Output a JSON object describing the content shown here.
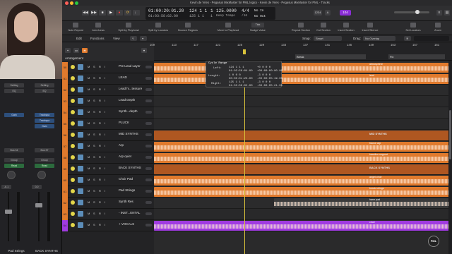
{
  "window": {
    "title": "Kevin de Vries - Pegasus MixMaster for PML.logicx - Kevin de Vries - Pegasus MixMaster for PML - Tracks"
  },
  "lcd": {
    "time_top": "01:00:20:01.20",
    "time_bottom": "01:03:58:02.00",
    "bars_top": "124 1 1",
    "bars_top_sub": "1",
    "bars_bottom": "125 1 1",
    "bars_bottom_sub": "1",
    "tempo": "125.0000",
    "tempo_label": "Keep Tempo",
    "sig": "4/4",
    "sig_bottom": "/16",
    "in_label": "No In",
    "out_label": "No Out"
  },
  "control": {
    "cpu_badge": "104",
    "btn_1234": "1234",
    "btn_a": "A"
  },
  "toolbar": {
    "items": [
      "Note Repeat",
      "Join Areas",
      "Split by Playhead",
      "Split by Locators",
      "Bounce Regions",
      "Move to Playhead",
      "Nudge Value",
      "Repeat Section",
      "Cut Section",
      "Insert Section",
      "Insert Silence",
      "Set Locators",
      "Zoom"
    ],
    "nudge_value": "Tick"
  },
  "trackbar": {
    "edit": "Edit",
    "functions": "Functions",
    "view": "View",
    "snap_label": "Snap:",
    "snap_value": "Smart",
    "drag_label": "Drag:",
    "drag_value": "No Overlap"
  },
  "ruler": {
    "bars": [
      "109",
      "113",
      "117",
      "121",
      "125",
      "129",
      "133",
      "137",
      "141",
      "145",
      "149",
      "153",
      "157",
      "161",
      "165"
    ],
    "markers": {
      "break": "Break",
      "fix": "Fix"
    },
    "arrangement": "Arrangement"
  },
  "tracks": [
    {
      "num": "50",
      "name": "Pre Lead Layer",
      "color": "#e07a2d"
    },
    {
      "num": "51",
      "name": "LEAD",
      "color": "#e07a2d"
    },
    {
      "num": "52",
      "name": "Lead hi...tessure",
      "color": "#e07a2d"
    },
    {
      "num": "53",
      "name": "Lead Depth",
      "color": "#e07a2d"
    },
    {
      "num": "54",
      "name": "Synth...depth",
      "color": "#e07a2d"
    },
    {
      "num": "55",
      "name": "PLUCK",
      "color": "#e07a2d"
    },
    {
      "num": "56",
      "name": "MID SYNTHS",
      "color": "#e07a2d"
    },
    {
      "num": "57",
      "name": "Arp",
      "color": "#e07a2d"
    },
    {
      "num": "58",
      "name": "Arp quiet",
      "color": "#e07a2d"
    },
    {
      "num": "59",
      "name": "BACK SYNTHS",
      "color": "#e07a2d"
    },
    {
      "num": "60",
      "name": "Choir Pad",
      "color": "#e07a2d"
    },
    {
      "num": "61",
      "name": "Pad Strings",
      "color": "#e07a2d"
    },
    {
      "num": "62",
      "name": "Synth Res",
      "color": "#e07a2d"
    },
    {
      "num": "63",
      "name": "- INST...ENTAL",
      "color": "#e07a2d"
    },
    {
      "num": "64",
      "name": "+ VOCALS",
      "color": "#a03be0"
    }
  ],
  "track_buttons": {
    "m": "M",
    "s": "S",
    "r": "R",
    "i": "I"
  },
  "regions": {
    "atmosphere": "atmosphere",
    "lead": "lead",
    "mid_synths": "MID SYNTHS",
    "trance_arp": "trance arp",
    "bassline_support": "bassline support",
    "back_synths": "BACK SYNTHS",
    "angel_choir": "angel choir",
    "break_strings": "break strings",
    "synth_res": "harm pad",
    "vocals": "choir"
  },
  "cycle_popup": {
    "title": "Cycle Range",
    "left_label": "Left:",
    "left_bars": "124 1 1 1",
    "left_time": "01:03:56:04.00",
    "left_delta": "+0 0 0 0",
    "left_delta_time": "+00:00:00:00.00",
    "length_label": "Length:",
    "length_bars": "1 0 0 0",
    "length_time": "00:00:01:23.00",
    "length_delta": "-3 0 0 0",
    "length_delta_time": "-00:00:05:19.00",
    "right_label": "Right:",
    "right_bars": "125 1 1 1",
    "right_time": "01:03:58:02.00",
    "right_delta": "-3 0 0 0",
    "right_delta_time": "-00:00:05:21.00"
  },
  "mixer": {
    "left_strip": {
      "name": "Pad Strings",
      "setting": "Setting",
      "eq": "EQ",
      "output": "Bus 34",
      "group": "Group",
      "auto": "Read",
      "vol": "-6.1",
      "pan": "0"
    },
    "right_strip": {
      "name": "BACK SYNTHS",
      "setting": "Setting",
      "eq": "EQ",
      "output": "Bus 37",
      "group": "Group",
      "auto": "Read",
      "vol": "0.0",
      "pan": "0"
    },
    "left_slots": [
      "Gain",
      "",
      "",
      ""
    ],
    "right_slots": [
      "Trackspa",
      "Trackspa",
      "Gain",
      ""
    ]
  },
  "logo": "PML",
  "colors": {
    "orange": "#e07a2d",
    "purple": "#a03be0",
    "yellow": "#e3d64a",
    "playhead": "#d9c23b"
  }
}
